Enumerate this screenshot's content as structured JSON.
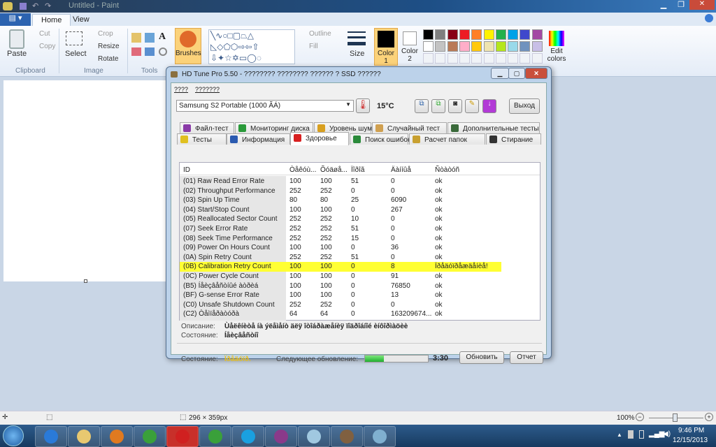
{
  "paint": {
    "title": "Untitled - Paint",
    "tabs": [
      "Home",
      "View"
    ],
    "clipboard": {
      "paste": "Paste",
      "cut": "Cut",
      "copy": "Copy",
      "group": "Clipboard"
    },
    "image": {
      "select": "Select",
      "crop": "Crop",
      "resize": "Resize",
      "rotate": "Rotate",
      "group": "Image"
    },
    "tools": {
      "group": "Tools"
    },
    "brushes": "Brushes",
    "shapes": {
      "outline": "Outline",
      "fill": "Fill"
    },
    "size": "Size",
    "color1": "Color 1",
    "color2": "Color 2",
    "edit_colors": "Edit colors",
    "palette_row1": [
      "#000000",
      "#7f7f7f",
      "#880015",
      "#ed1c24",
      "#ff7f27",
      "#fff200",
      "#22b14c",
      "#00a2e8",
      "#3f48cc",
      "#a349a4"
    ],
    "palette_row2": [
      "#ffffff",
      "#c3c3c3",
      "#b97a57",
      "#ffaec9",
      "#ffc90e",
      "#efe4b0",
      "#b5e61d",
      "#99d9ea",
      "#7092be",
      "#c8bfe7"
    ],
    "status": {
      "size": "296 × 359px",
      "zoom": "100%"
    }
  },
  "taskbar": {
    "time": "9:46 PM",
    "date": "12/15/2013",
    "apps": [
      "internet-explorer",
      "file-explorer",
      "media-player",
      "chrome",
      "opera",
      "chrome",
      "skype",
      "winrar",
      "notepad",
      "hd-tune",
      "paint"
    ]
  },
  "hdtune": {
    "title": "HD Tune Pro 5.50 - ???????? ???????? ?????? ? SSD ??????",
    "menu": [
      "????",
      "???????"
    ],
    "drive": "Samsung S2 Portable (1000 ÃÁ)",
    "temperature": "15°C",
    "exit": "Выход",
    "tabs_row1": [
      "Файл-тест",
      "Мониторинг диска",
      "Уровень шума",
      "Случайный тест",
      "Дополнительные тесты"
    ],
    "tabs_row2": [
      "Тесты",
      "Информация",
      "Здоровье",
      "Поиск ошибок",
      "Расчет папок",
      "Стирание"
    ],
    "columns": [
      "ID",
      "Òåêóù...",
      "Õóäøå...",
      "Ïîðîã",
      "Äàííûå",
      "Ñòàòóñ"
    ],
    "rows": [
      [
        "(01) Raw Read Error Rate",
        "100",
        "100",
        "51",
        "0",
        "ok"
      ],
      [
        "(02) Throughput Performance",
        "252",
        "252",
        "0",
        "0",
        "ok"
      ],
      [
        "(03) Spin Up Time",
        "80",
        "80",
        "25",
        "6090",
        "ok"
      ],
      [
        "(04) Start/Stop Count",
        "100",
        "100",
        "0",
        "267",
        "ok"
      ],
      [
        "(05) Reallocated Sector Count",
        "252",
        "252",
        "10",
        "0",
        "ok"
      ],
      [
        "(07) Seek Error Rate",
        "252",
        "252",
        "51",
        "0",
        "ok"
      ],
      [
        "(08) Seek Time Performance",
        "252",
        "252",
        "15",
        "0",
        "ok"
      ],
      [
        "(09) Power On Hours Count",
        "100",
        "100",
        "0",
        "36",
        "ok"
      ],
      [
        "(0A) Spin Retry Count",
        "252",
        "252",
        "51",
        "0",
        "ok"
      ],
      [
        "(0B) Calibration Retry Count",
        "100",
        "100",
        "0",
        "8",
        "Ïðåäóïðåæäåíèå!"
      ],
      [
        "(0C) Power Cycle Count",
        "100",
        "100",
        "0",
        "91",
        "ok"
      ],
      [
        "(B5) Íåèçâåñòíûé àòðèá",
        "100",
        "100",
        "0",
        "76850",
        "ok"
      ],
      [
        "(BF) G-sense Error Rate",
        "100",
        "100",
        "0",
        "13",
        "ok"
      ],
      [
        "(C0) Unsafe Shutdown Count",
        "252",
        "252",
        "0",
        "0",
        "ok"
      ],
      [
        "(C2) Òåìïåðàòóðà",
        "64",
        "64",
        "0",
        "163209674...",
        "ok"
      ]
    ],
    "highlight_row": 9,
    "highlight_color": "#ffff33",
    "desc_label": "Описание:",
    "desc_value": "Ùåëêíèòå íà ýëåìåíò äëÿ îòîáðàæåíèÿ ïîäðîáíîé èíôîðìàöèè",
    "state_label": "Состояние:",
    "state_value": "Íåèçâåñòíî",
    "status_label": "Состояние:",
    "status_value": "Ïðåäóïð.",
    "next_update_label": "Следующее обновление:",
    "progress": 0.3,
    "countdown": "3:30",
    "refresh": "Обновить",
    "report": "Отчет"
  }
}
